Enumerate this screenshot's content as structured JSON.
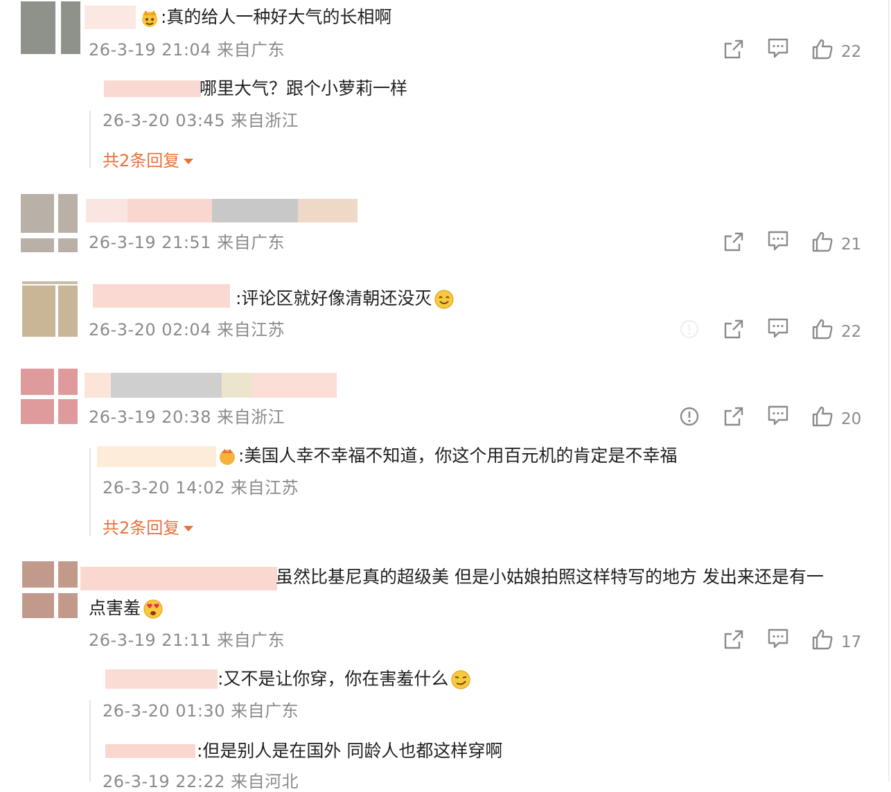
{
  "comments": [
    {
      "text": ":真的给人一种好大气的长相啊",
      "meta": "26-3-19 21:04 来自广东",
      "likes": "22",
      "replies": [
        {
          "text": "哪里大气？跟个小萝莉一样",
          "meta": "26-3-20 03:45 来自浙江"
        }
      ],
      "more_label": "共2条回复"
    },
    {
      "text": "",
      "meta": "26-3-19 21:51 来自广东",
      "likes": "21"
    },
    {
      "text": ":评论区就好像清朝还没灭",
      "meta": "26-3-20 02:04 来自江苏",
      "likes": "22"
    },
    {
      "text": "",
      "meta": "26-3-19 20:38 来自浙江",
      "likes": "20",
      "replies": [
        {
          "text": ":美国人幸不幸福不知道，你这个用百元机的肯定是不幸福",
          "meta": "26-3-20 14:02 来自江苏"
        }
      ],
      "more_label": "共2条回复"
    },
    {
      "text_line1": "虽然比基尼真的超级美 但是小姑娘拍照这样特写的地方 发出来还是有一",
      "text_line2": "点害羞",
      "meta": "26-3-19 21:11 来自广东",
      "likes": "17",
      "replies": [
        {
          "text": ":又不是让你穿，你在害羞什么",
          "meta": "26-3-20 01:30 来自广东"
        },
        {
          "text": ":但是别人是在国外 同龄人也都这样穿啊",
          "meta": "26-3-19 22:22 来自河北"
        }
      ]
    }
  ],
  "icons": {
    "share": "share-icon",
    "comment": "comment-icon",
    "like": "thumbs-up-icon",
    "report": "report-icon"
  },
  "colors": {
    "more_link": "#e8713a",
    "meta_text": "#8a8a8a"
  }
}
